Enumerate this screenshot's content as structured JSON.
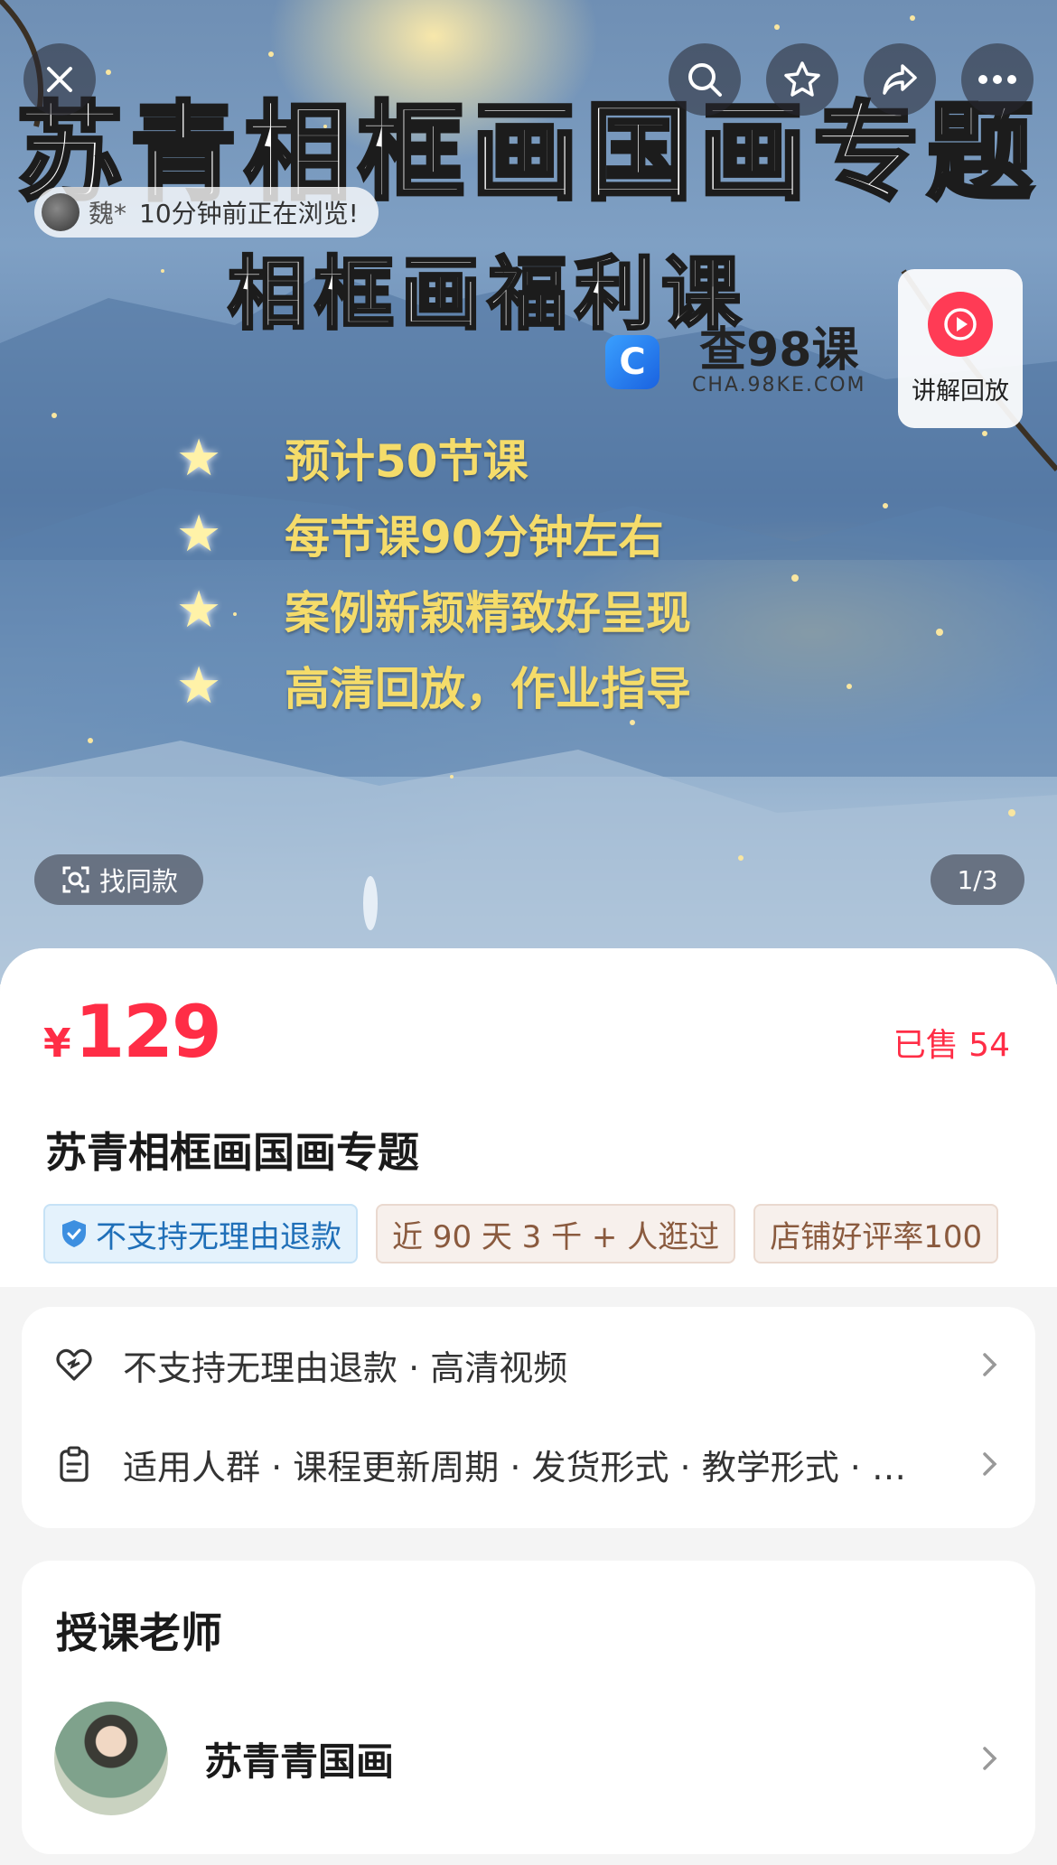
{
  "hero": {
    "title": "苏青相框画国画专题",
    "subtitle": "相框画福利课",
    "features": [
      "预计50节课",
      "每节课90分钟左右",
      "案例新颖精致好呈现",
      "高清回放，作业指导"
    ],
    "watermark_main": "查98课",
    "watermark_sub": "CHA.98KE.COM",
    "watermark_logo": "C",
    "viewer_name": "魏*",
    "viewer_text": "10分钟前正在浏览!",
    "replay_label": "讲解回放",
    "find_similar_label": "找同款",
    "page_indicator": "1/3",
    "icons": [
      "close-icon",
      "search-icon",
      "star-icon",
      "share-icon",
      "more-icon",
      "play-icon",
      "scan-icon"
    ]
  },
  "product": {
    "currency": "¥",
    "price": "129",
    "sold": "已售 54",
    "title": "苏青相框画国画专题",
    "tags": [
      "不支持无理由退款",
      "近 90 天 3 千 + 人逛过",
      "店铺好评率100"
    ]
  },
  "attributes": {
    "row1": "不支持无理由退款 · 高清视频",
    "row2": "适用人群 · 课程更新周期 · 发货形式 · 教学形式 · …"
  },
  "teacher": {
    "heading": "授课老师",
    "name": "苏青青国画"
  },
  "colors": {
    "price_red": "#ff2d46",
    "replay_red": "#ff3b55",
    "tag_blue": "#1f6fb8",
    "tag_tan": "#8a5a3e"
  }
}
